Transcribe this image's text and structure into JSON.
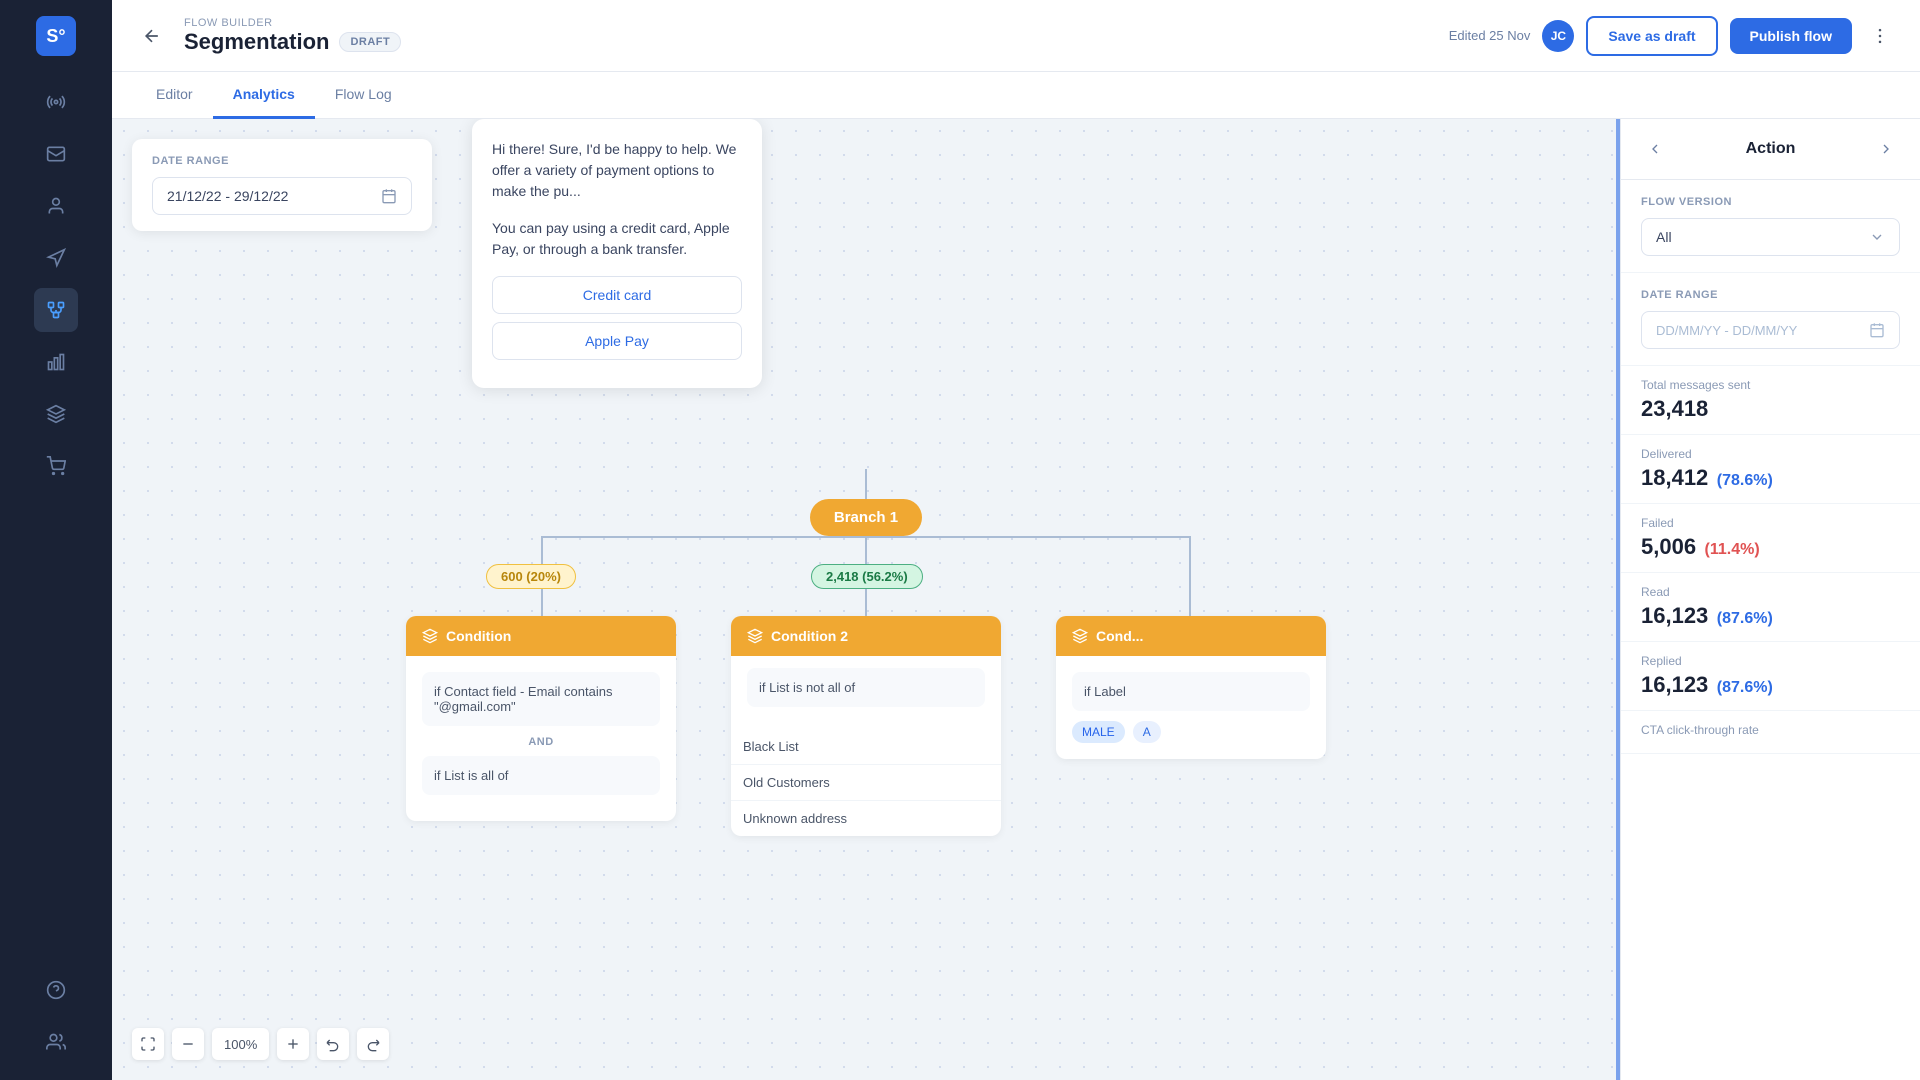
{
  "app": {
    "logo": "S"
  },
  "header": {
    "breadcrumb": "FLOW BUILDER",
    "title": "Segmentation",
    "badge": "DRAFT",
    "edited_label": "Edited 25 Nov",
    "avatar_initials": "JC",
    "save_draft_label": "Save as draft",
    "publish_label": "Publish flow"
  },
  "tabs": [
    {
      "id": "editor",
      "label": "Editor"
    },
    {
      "id": "analytics",
      "label": "Analytics",
      "active": true
    },
    {
      "id": "flow-log",
      "label": "Flow Log"
    }
  ],
  "canvas": {
    "date_range_label": "DATE RANGE",
    "date_range_value": "21/12/22 - 29/12/22",
    "chat": {
      "text1": "Hi there! Sure, I'd be happy to help. We offer a variety of payment options to make the pu...",
      "text2": "You can pay using a credit card, Apple Pay, or through a bank transfer.",
      "btn1": "Credit card",
      "btn2": "Apple Pay"
    },
    "branch": {
      "label": "Branch 1",
      "badge1": "600 (20%)",
      "badge2": "2,418 (56.2%)"
    },
    "condition1": {
      "header": "Condition",
      "rule1": "if Contact field - Email contains \"@gmail.com\"",
      "divider": "AND",
      "rule2": "if List is all of"
    },
    "condition2": {
      "header": "Condition 2",
      "rule": "if List is not all of",
      "items": [
        "Black List",
        "Old Customers",
        "Unknown address"
      ]
    },
    "condition3": {
      "header": "Cond...",
      "rule": "if Label",
      "tags": [
        "MALE"
      ]
    }
  },
  "toolbar": {
    "zoom": "100%"
  },
  "right_panel": {
    "title": "Action",
    "flow_version_label": "FLOW VERSION",
    "flow_version_value": "All",
    "date_range_label": "DATE RANGE",
    "date_range_placeholder": "DD/MM/YY - DD/MM/YY",
    "stats": [
      {
        "label": "Total messages sent",
        "value": "23,418",
        "pct": "",
        "pct_class": ""
      },
      {
        "label": "Delivered",
        "value": "18,412",
        "pct": "(78.6%)",
        "pct_class": "blue"
      },
      {
        "label": "Failed",
        "value": "5,006",
        "pct": "(11.4%)",
        "pct_class": "red"
      },
      {
        "label": "Read",
        "value": "16,123",
        "pct": "(87.6%)",
        "pct_class": "blue"
      },
      {
        "label": "Replied",
        "value": "16,123",
        "pct": "(87.6%)",
        "pct_class": "blue"
      },
      {
        "label": "CTA click-through rate",
        "value": "",
        "pct": "",
        "pct_class": ""
      }
    ]
  },
  "sidebar": {
    "items": [
      {
        "name": "broadcast",
        "icon": "radio"
      },
      {
        "name": "inbox",
        "icon": "inbox"
      },
      {
        "name": "contacts",
        "icon": "user"
      },
      {
        "name": "campaigns",
        "icon": "megaphone"
      },
      {
        "name": "flows",
        "icon": "flows",
        "active": true
      },
      {
        "name": "analytics",
        "icon": "chart"
      },
      {
        "name": "integrations",
        "icon": "puzzle"
      },
      {
        "name": "ecommerce",
        "icon": "cart"
      }
    ]
  }
}
